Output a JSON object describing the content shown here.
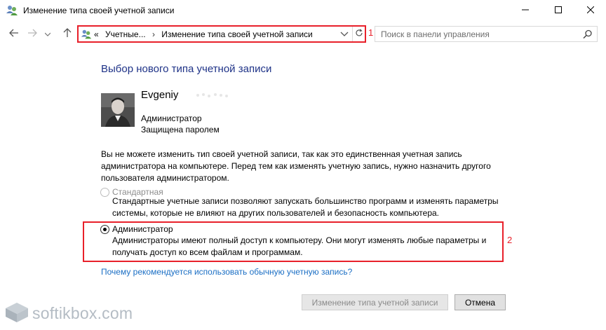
{
  "window": {
    "title": "Изменение типа своей учетной записи",
    "icon": "user-accounts-icon"
  },
  "navigation": {
    "breadcrumb_prefix": "«",
    "breadcrumbs": [
      "Учетные...",
      "Изменение типа своей учетной записи"
    ],
    "separator": "›",
    "search_placeholder": "Поиск в панели управления",
    "marker_1": "1"
  },
  "content": {
    "heading": "Выбор нового типа учетной записи",
    "user": {
      "name": "Evgeniy",
      "role": "Администратор",
      "password_status": "Защищена паролем"
    },
    "warning": "Вы не можете изменить тип своей учетной записи, так как это единственная учетная запись администратора на компьютере. Перед тем как изменять учетную запись, нужно назначить другого пользователя администратором.",
    "options": [
      {
        "label": "Стандартная",
        "description": "Стандартные учетные записи позволяют запускать большинство программ и изменять параметры системы, которые не влияют на других пользователей и безопасность компьютера.",
        "selected": false,
        "enabled": false
      },
      {
        "label": "Администратор",
        "description": "Администраторы имеют полный доступ к компьютеру. Они могут изменять любые параметры и получать доступ ко всем файлам и программам.",
        "selected": true,
        "enabled": true
      }
    ],
    "marker_2": "2",
    "why_link": "Почему рекомендуется использовать обычную учетную запись?"
  },
  "buttons": {
    "change": "Изменение типа учетной записи",
    "cancel": "Отмена"
  },
  "watermark": "softikbox.com",
  "colors": {
    "heading": "#1e3287",
    "link": "#1a6ec4",
    "highlight": "#e8202a"
  }
}
